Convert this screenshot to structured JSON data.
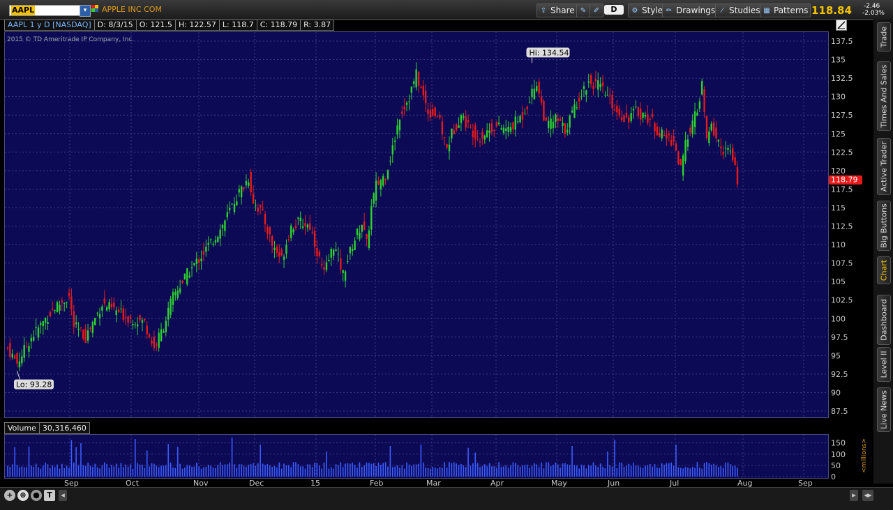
{
  "toolbar": {
    "symbol": "AAPL",
    "company": "APPLE INC COM",
    "share_label": "Share",
    "style_label": "Style",
    "drawings_label": "Drawings",
    "studies_label": "Studies",
    "patterns_label": "Patterns",
    "aggregation": "D",
    "last_price": "118.84",
    "change": "-2.46",
    "change_pct": "-2.03%"
  },
  "info": {
    "title": "AAPL 1 y D [NASDAQ]",
    "date": "D: 8/3/15",
    "open": "O: 121.5",
    "high": "H: 122.57",
    "low": "L: 118.7",
    "close": "C: 118.79",
    "range": "R: 3.87"
  },
  "copyright": "2015 © TD Ameritrade IP Company, Inc.",
  "hi_label": "Hi: 134.54",
  "lo_label": "Lo: 93.28",
  "current_price_tag": "118.79",
  "volume": {
    "label": "Volume",
    "value": "30,316,460",
    "unit_label": "<millions>"
  },
  "side_tabs": [
    "Trade",
    "Times And Sales",
    "Active Trader",
    "Big Buttons",
    "Chart",
    "Dashboard",
    "Level II",
    "Live News"
  ],
  "colors": {
    "background": "#0d0a55",
    "up": "#2fd12f",
    "down": "#e81a1a",
    "volume": "#3a5cff",
    "accent": "#f2c200"
  },
  "chart_data": {
    "type": "candlestick",
    "price_axis": {
      "range": [
        87.5,
        137.5
      ],
      "ticks": [
        "137.5",
        "135",
        "132.5",
        "130",
        "127.5",
        "125",
        "122.5",
        "120",
        "117.5",
        "115",
        "112.5",
        "110",
        "107.5",
        "105",
        "102.5",
        "100",
        "97.5",
        "95",
        "92.5",
        "90",
        "87.5"
      ]
    },
    "volume_axis": {
      "range": [
        0,
        180
      ],
      "ticks": [
        "150",
        "100",
        "50",
        "0"
      ]
    },
    "x_labels": [
      "Sep",
      "Oct",
      "Nov",
      "Dec",
      "15",
      "Feb",
      "Mar",
      "Apr",
      "May",
      "Jun",
      "Jul",
      "Aug",
      "Sep"
    ],
    "path": [
      {
        "i": 0,
        "p": 96
      },
      {
        "i": 4,
        "p": 94
      },
      {
        "i": 10,
        "p": 97.5
      },
      {
        "i": 20,
        "p": 101.5
      },
      {
        "i": 26,
        "p": 103
      },
      {
        "i": 28,
        "p": 99
      },
      {
        "i": 33,
        "p": 97.5
      },
      {
        "i": 40,
        "p": 102
      },
      {
        "i": 46,
        "p": 101
      },
      {
        "i": 52,
        "p": 100
      },
      {
        "i": 58,
        "p": 99.5
      },
      {
        "i": 62,
        "p": 96
      },
      {
        "i": 66,
        "p": 99
      },
      {
        "i": 70,
        "p": 103
      },
      {
        "i": 76,
        "p": 106
      },
      {
        "i": 82,
        "p": 108.5
      },
      {
        "i": 90,
        "p": 112
      },
      {
        "i": 97,
        "p": 116.5
      },
      {
        "i": 102,
        "p": 119
      },
      {
        "i": 104,
        "p": 116
      },
      {
        "i": 108,
        "p": 114
      },
      {
        "i": 112,
        "p": 110
      },
      {
        "i": 116,
        "p": 108
      },
      {
        "i": 120,
        "p": 112.5
      },
      {
        "i": 124,
        "p": 113
      },
      {
        "i": 128,
        "p": 112.5
      },
      {
        "i": 132,
        "p": 108
      },
      {
        "i": 134,
        "p": 106
      },
      {
        "i": 138,
        "p": 110
      },
      {
        "i": 140,
        "p": 108
      },
      {
        "i": 142,
        "p": 106
      },
      {
        "i": 146,
        "p": 110
      },
      {
        "i": 150,
        "p": 113
      },
      {
        "i": 152,
        "p": 110
      },
      {
        "i": 154,
        "p": 115
      },
      {
        "i": 156,
        "p": 118
      },
      {
        "i": 160,
        "p": 119.5
      },
      {
        "i": 163,
        "p": 123
      },
      {
        "i": 166,
        "p": 127.5
      },
      {
        "i": 170,
        "p": 130
      },
      {
        "i": 173,
        "p": 133
      },
      {
        "i": 175,
        "p": 131
      },
      {
        "i": 178,
        "p": 128
      },
      {
        "i": 182,
        "p": 127.5
      },
      {
        "i": 186,
        "p": 123
      },
      {
        "i": 188,
        "p": 125
      },
      {
        "i": 192,
        "p": 127.5
      },
      {
        "i": 196,
        "p": 125.5
      },
      {
        "i": 200,
        "p": 124.5
      },
      {
        "i": 206,
        "p": 126
      },
      {
        "i": 212,
        "p": 125.5
      },
      {
        "i": 218,
        "p": 127.5
      },
      {
        "i": 224,
        "p": 132
      },
      {
        "i": 226,
        "p": 129
      },
      {
        "i": 228,
        "p": 126
      },
      {
        "i": 232,
        "p": 127
      },
      {
        "i": 236,
        "p": 125.5
      },
      {
        "i": 242,
        "p": 130
      },
      {
        "i": 246,
        "p": 132
      },
      {
        "i": 250,
        "p": 131.5
      },
      {
        "i": 254,
        "p": 130
      },
      {
        "i": 258,
        "p": 128
      },
      {
        "i": 262,
        "p": 127
      },
      {
        "i": 266,
        "p": 128
      },
      {
        "i": 272,
        "p": 127
      },
      {
        "i": 276,
        "p": 125
      },
      {
        "i": 282,
        "p": 124
      },
      {
        "i": 285,
        "p": 120
      },
      {
        "i": 288,
        "p": 125
      },
      {
        "i": 292,
        "p": 128
      },
      {
        "i": 294,
        "p": 131.5
      },
      {
        "i": 296,
        "p": 124
      },
      {
        "i": 298,
        "p": 126
      },
      {
        "i": 302,
        "p": 123
      },
      {
        "i": 306,
        "p": 122.5
      },
      {
        "i": 309,
        "p": 118.8
      }
    ],
    "hi": 134.54,
    "lo": 93.28,
    "last": 118.79
  }
}
